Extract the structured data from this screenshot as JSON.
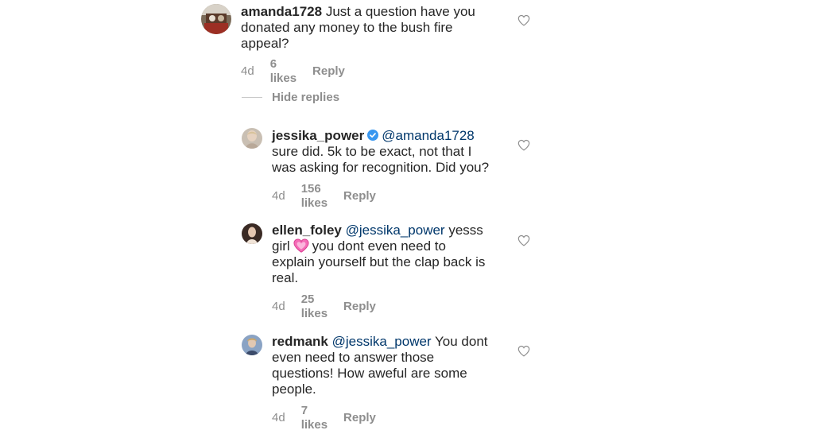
{
  "comments": [
    {
      "username": "amanda1728",
      "mention": "",
      "text_lines": [
        "Just a question have you",
        "donated any money to the bush fire",
        "appeal?"
      ],
      "time": "4d",
      "likes": "6 likes",
      "reply": "Reply"
    },
    {
      "username": "jessika_power",
      "mention": "@amanda1728",
      "text_lines": [
        "sure did. 5k to be exact, not that I",
        "was asking for recognition. Did you?"
      ],
      "time": "4d",
      "likes": "156 likes",
      "reply": "Reply"
    },
    {
      "username": "ellen_foley",
      "mention": "@jessika_power",
      "text_first": "yesss",
      "text_lines": [
        "girl",
        "you dont even need to",
        "explain yourself but the clap back is",
        "real."
      ],
      "time": "4d",
      "likes": "25 likes",
      "reply": "Reply"
    },
    {
      "username": "redmank",
      "mention": "@jessika_power",
      "text_first": "You dont",
      "text_lines": [
        "even need to answer those",
        "questions! How aweful are some",
        "people."
      ],
      "time": "4d",
      "likes": "7 likes",
      "reply": "Reply"
    }
  ],
  "hide_replies_label": "Hide replies",
  "icons": {
    "like": "heart-outline-icon",
    "verified": "verified-badge-icon",
    "emoji": "sparkling-heart-emoji"
  },
  "colors": {
    "text": "#262626",
    "secondary": "#8e8e8e",
    "mention": "#00376b",
    "verified": "#3897f0"
  }
}
